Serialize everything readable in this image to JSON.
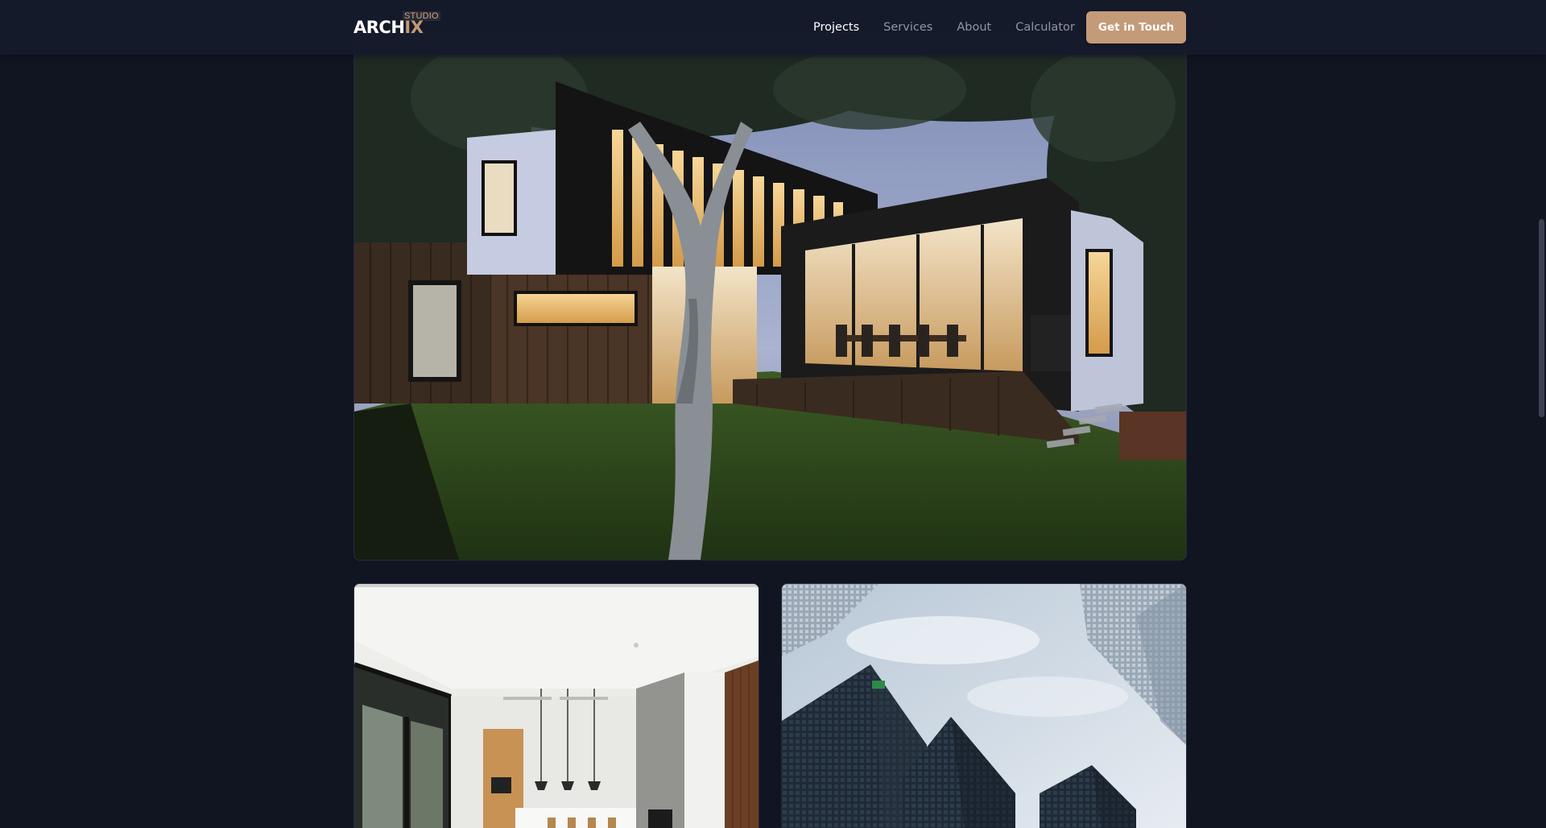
{
  "navbar": {
    "logo": {
      "main_prefix": "ARCH",
      "main_accent": "IX",
      "sub": "STUDIO"
    },
    "links": [
      {
        "label": "Projects",
        "active": true
      },
      {
        "label": "Services",
        "active": false
      },
      {
        "label": "About",
        "active": false
      },
      {
        "label": "Calculator",
        "active": false
      }
    ],
    "cta_label": "Get in Touch"
  },
  "projects": [
    {
      "image": "modern-house-night-photo"
    },
    {
      "image": "modern-kitchen-interior-photo"
    },
    {
      "image": "skyscrapers-from-below-photo"
    }
  ],
  "theme": {
    "background": "#111522",
    "accent": "#c39b79",
    "nav_text": "#8e95a7",
    "nav_active": "#ffffff"
  }
}
